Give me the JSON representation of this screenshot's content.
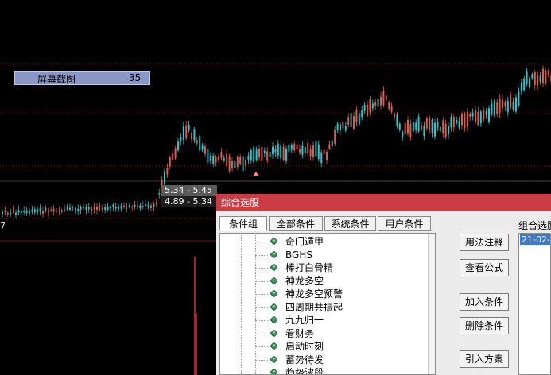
{
  "chart_overlay": {
    "badge_label": "屏幕截图",
    "badge_value": "35",
    "range_upper": "5.34 - 5.45",
    "range_lower": "4.89 - 5.34",
    "indicator_value": "7"
  },
  "colors": {
    "up": "#e05a4a",
    "down": "#27c8cf",
    "grid": "#8b1d1d",
    "title_bar": "#cc3c44"
  },
  "dialog": {
    "title": "综合选股",
    "tabs": [
      "条件组",
      "全部条件",
      "系统条件",
      "用户条件"
    ],
    "active_tab": "条件组",
    "items": [
      "奇门遁甲",
      "BGHS",
      "棒打白骨精",
      "神龙多空",
      "神龙多空预警",
      "四周期共振起",
      "九九归一",
      "看财务",
      "启动时刻",
      "蓄势待发",
      "趋势波段"
    ],
    "item_icon": "green-diamond-icon",
    "buttons": {
      "usage_note": "用法注释",
      "view_formula": "查看公式",
      "add_condition": "加入条件",
      "delete_condition": "删除条件",
      "import_plan": "引入方案"
    },
    "combo_title": "组合选股",
    "combo_selected": "21-02-"
  }
}
